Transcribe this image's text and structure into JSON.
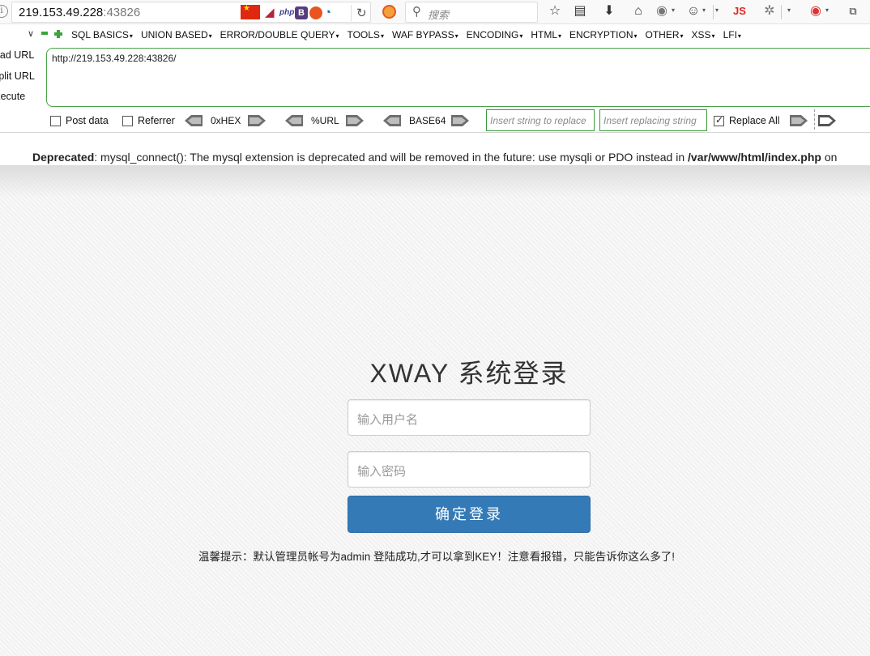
{
  "browser": {
    "url_host": "219.153.49.228",
    "url_port": ":43826",
    "search_placeholder": "搜索",
    "js_badge": "JS",
    "extensions": [
      "php",
      "B"
    ]
  },
  "hackbar": {
    "menu": [
      "SQL BASICS",
      "UNION BASED",
      "ERROR/DOUBLE QUERY",
      "TOOLS",
      "WAF BYPASS",
      "ENCODING",
      "HTML",
      "ENCRYPTION",
      "OTHER",
      "XSS",
      "LFI"
    ],
    "load_url": "Load URL",
    "split_url": "Split URL",
    "execute": "Execute",
    "url_value": "http://219.153.49.228:43826/",
    "post_data": "Post data",
    "referrer": "Referrer",
    "hex": "0xHEX",
    "url_enc": "%URL",
    "base64": "BASE64",
    "replace_placeholder": "Insert string to replace",
    "replacing_placeholder": "Insert replacing string",
    "replace_all": "Replace All",
    "replace_all_checked": true
  },
  "page": {
    "warning_label": "Deprecated",
    "warning_text": ": mysql_connect(): The mysql extension is deprecated and will be removed in the future: use mysqli or PDO instead in ",
    "warning_path": "/var/www/html/index.php",
    "warning_tail": " on",
    "title": "XWAY 系统登录",
    "username_placeholder": "输入用户名",
    "password_placeholder": "输入密码",
    "login_button": "确定登录",
    "hint": "温馨提示：默认管理员帐号为admin 登陆成功,才可以拿到KEY！注意看报错，只能告诉你这么多了!"
  },
  "colors": {
    "accent": "#337ab7",
    "hackbar_green": "#3aa53a",
    "js_red": "#e0241b"
  }
}
